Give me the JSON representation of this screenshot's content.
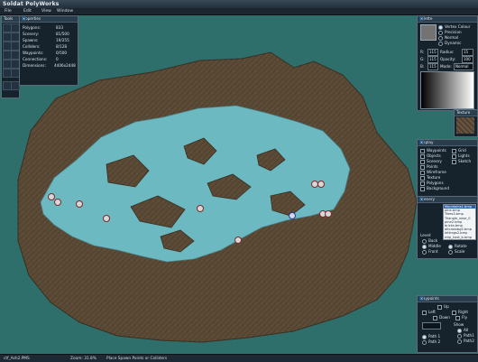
{
  "app": {
    "title": "Soldat PolyWorks"
  },
  "menu": [
    "File",
    "Edit",
    "View",
    "Window"
  ],
  "tools_panel": {
    "title": "Tools"
  },
  "properties_panel": {
    "title": "Properties",
    "rows": [
      {
        "label": "Polygons:",
        "value": "833"
      },
      {
        "label": "Scenery:",
        "value": "81/500"
      },
      {
        "label": "Spawns:",
        "value": "19/255"
      },
      {
        "label": "Colliders:",
        "value": "8/128"
      },
      {
        "label": "Waypoints:",
        "value": "0/500"
      },
      {
        "label": "Connections:",
        "value": "0"
      },
      {
        "label": "Dimensions:",
        "value": "4406x2448"
      }
    ]
  },
  "palette_panel": {
    "title": "Palette",
    "modes": [
      {
        "label": "Vertex Colour",
        "selected": true
      },
      {
        "label": "Precision",
        "selected": false
      },
      {
        "label": "Normal",
        "selected": false
      },
      {
        "label": "Dynamic",
        "selected": false
      }
    ],
    "r_label": "R:",
    "r_value": "115",
    "g_label": "G:",
    "g_value": "115",
    "b_label": "B:",
    "b_value": "115",
    "radius_label": "Radius:",
    "radius_value": "15",
    "opacity_label": "Opacity:",
    "opacity_value": "100",
    "mode_label": "Mode:",
    "mode_value": "Normal",
    "swatch_color": "#737373"
  },
  "texture_panel": {
    "title": "Texture"
  },
  "display_panel": {
    "title": "Display",
    "items": [
      {
        "label": "Waypoints",
        "checked": true
      },
      {
        "label": "Grid",
        "checked": false
      },
      {
        "label": "Objects",
        "checked": true
      },
      {
        "label": "Lights",
        "checked": true
      },
      {
        "label": "Scenery",
        "checked": true
      },
      {
        "label": "Sketch",
        "checked": true
      },
      {
        "label": "Points",
        "checked": false
      },
      {
        "label": "Wireframe",
        "checked": false
      },
      {
        "label": "Texture",
        "checked": true
      },
      {
        "label": "Polygons",
        "checked": true
      },
      {
        "label": "Background",
        "checked": true
      }
    ]
  },
  "scenery_panel": {
    "title": "Scenery",
    "list": [
      "Mountains1.bmp",
      "pine.bmp",
      "Trees3.bmp",
      "Triangle_nose_0",
      "pine2.bmp",
      "bricks.bmp",
      "altcrossbg2.bmp",
      "lettrags2.bmp",
      "mtp_hast_b.bmp"
    ],
    "level_label": "Level:",
    "levels": [
      {
        "label": "Back",
        "selected": false
      },
      {
        "label": "Middle",
        "selected": true
      },
      {
        "label": "Front",
        "selected": false
      }
    ],
    "transforms": [
      {
        "label": "Rotate",
        "selected": true
      },
      {
        "label": "Scale",
        "selected": false
      }
    ]
  },
  "waypoints_panel": {
    "title": "Waypoints",
    "directions": [
      "Up",
      "Left",
      "Right",
      "Down",
      "Fly"
    ],
    "show_label": "Show",
    "show_options": [
      "All",
      "Path1",
      "Path2"
    ],
    "paths": [
      {
        "label": "Path 1",
        "selected": true
      },
      {
        "label": "Path 2",
        "selected": false
      }
    ]
  },
  "status": {
    "file": "ctf_Ash2.PMS",
    "zoom": "Zoom: 31.8%",
    "hint": "Place Spawn Points or Colliders"
  },
  "colors": {
    "background": "#2f6f6b",
    "terrain": "#5a4a36",
    "cave": "#6cb9c2",
    "panel_bg": "#16222c"
  }
}
